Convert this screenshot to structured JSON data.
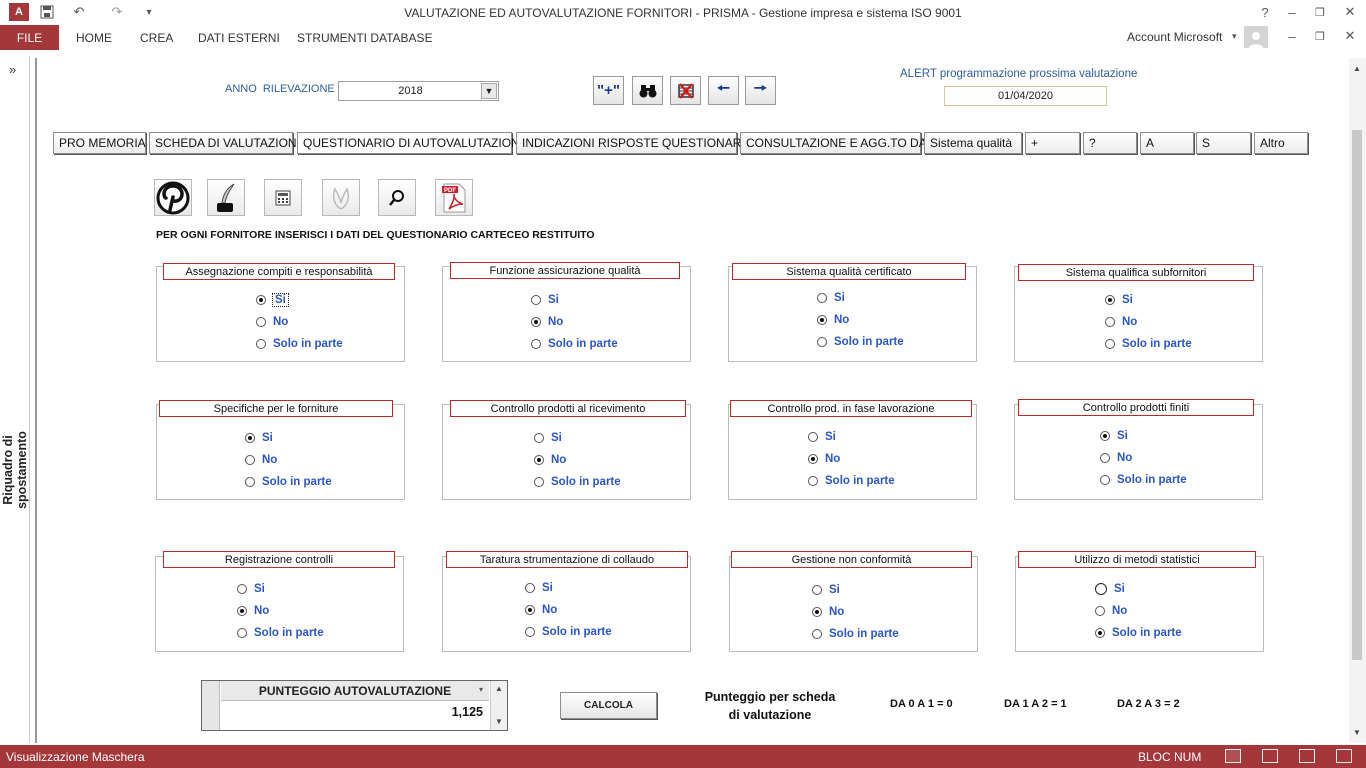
{
  "window": {
    "title": "VALUTAZIONE ED AUTOVALUTAZIONE FORNITORI - PRISMA - Gestione impresa e sistema ISO 9001",
    "help": "?",
    "controls": [
      "–",
      "❐",
      "✕"
    ]
  },
  "ribbon": {
    "file": "FILE",
    "tabs": [
      "HOME",
      "CREA",
      "DATI ESTERNI",
      "STRUMENTI DATABASE"
    ],
    "account": "Account Microsoft"
  },
  "nav_pane": {
    "collapse": "»",
    "label": "Riquadro di spostamento"
  },
  "header": {
    "year_label": "ANNO RILEVAZIONE",
    "year_value": "2018",
    "alert_label": "ALERT programmazione prossima valutazione",
    "alert_date": "01/04/2020",
    "toolbar": {
      "add": "\"+\"",
      "search": "binoculars-icon",
      "delete": "delete-record-icon",
      "prev": "arrow-left-icon",
      "next": "arrow-right-icon"
    }
  },
  "nav_buttons": [
    "PRO MEMORIA",
    "SCHEDA DI VALUTAZIONE",
    "QUESTIONARIO DI AUTOVALUTAZIONE",
    "INDICAZIONI RISPOSTE QUESTIONARIO",
    "CONSULTAZIONE E AGG.TO DATI",
    "Sistema qualità",
    "+",
    "?",
    "A",
    "S",
    "Altro"
  ],
  "selected_nav": "QUESTIONARIO DI AUTOVALUTAZIONE",
  "icon_buttons": [
    "pinterest-icon",
    "quill-ink-icon",
    "calculator-icon",
    "leaf-icon",
    "magnifier-icon",
    "pdf-icon"
  ],
  "instruction": "PER OGNI FORNITORE INSERISCI I DATI DEL QUESTIONARIO CARTECEO RESTITUITO",
  "options": [
    "Si",
    "No",
    "Solo in parte"
  ],
  "groups": [
    {
      "title": "Assegnazione compiti e responsabilità",
      "selected": "Si"
    },
    {
      "title": "Funzione assicurazione qualità",
      "selected": "No"
    },
    {
      "title": "Sistema qualità certificato",
      "selected": "No"
    },
    {
      "title": "Sistema qualifica subfornitori",
      "selected": "Si"
    },
    {
      "title": "Specifiche per le forniture",
      "selected": "Si"
    },
    {
      "title": "Controllo prodotti al ricevimento",
      "selected": "No"
    },
    {
      "title": "Controllo prod. in fase lavorazione",
      "selected": "No"
    },
    {
      "title": "Controllo prodotti finiti",
      "selected": "Si"
    },
    {
      "title": "Registrazione controlli",
      "selected": "No"
    },
    {
      "title": "Taratura strumentazione di collaudo",
      "selected": "No"
    },
    {
      "title": "Gestione non conformità",
      "selected": "No"
    },
    {
      "title": "Utilizzo di metodi statistici",
      "selected": "Solo in parte"
    }
  ],
  "score": {
    "label": "PUNTEGGIO AUTOVALUTAZIONE",
    "value": "1,125"
  },
  "calc_button": "CALCOLA",
  "legend": {
    "title_line1": "Punteggio per scheda",
    "title_line2": "di valutazione",
    "ranges": [
      "DA 0 A 1 = 0",
      "DA 1 A 2 = 1",
      "DA 2 A 3 = 2"
    ]
  },
  "status": {
    "left": "Visualizzazione Maschera",
    "right": "BLOC NUM"
  },
  "colors": {
    "accent": "#a4373a",
    "option_text": "#2b56c4",
    "label_blue": "#2f5d99",
    "group_border": "#c0272d"
  }
}
